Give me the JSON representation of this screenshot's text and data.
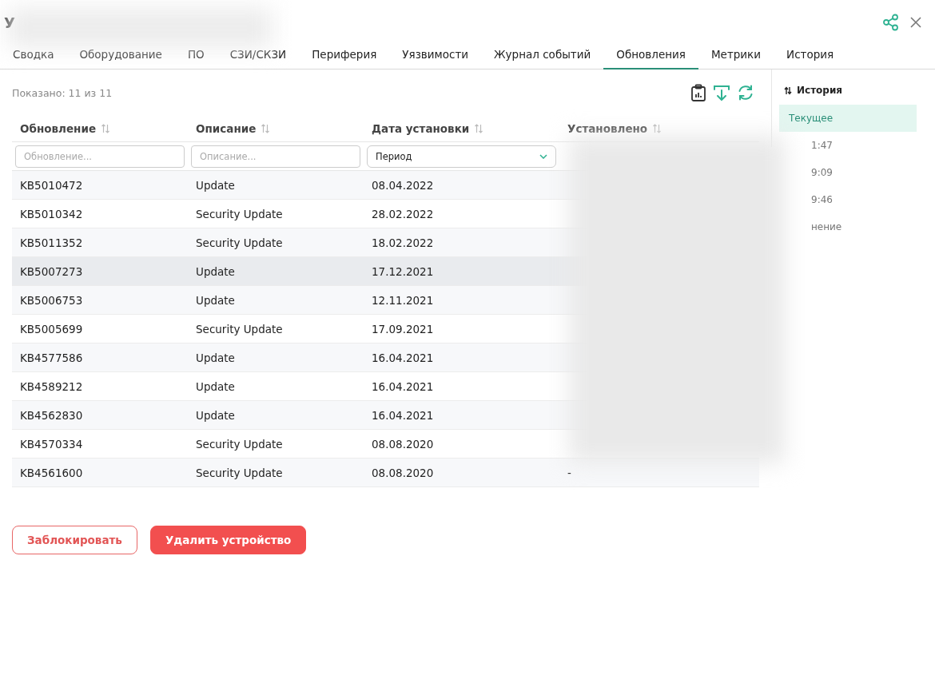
{
  "window": {
    "title": "У"
  },
  "tabs": [
    {
      "label": "Сводка",
      "selected": false
    },
    {
      "label": "Оборудование",
      "selected": false
    },
    {
      "label": "ПО",
      "selected": false
    },
    {
      "label": "СЗИ/СКЗИ",
      "selected": false
    },
    {
      "label": "Периферия",
      "selected": false
    },
    {
      "label": "Уязвимости",
      "selected": false
    },
    {
      "label": "Журнал событий",
      "selected": false
    },
    {
      "label": "Обновления",
      "selected": true
    },
    {
      "label": "Метрики",
      "selected": false
    },
    {
      "label": "История",
      "selected": false
    }
  ],
  "shown_count": "Показано: 11 из 11",
  "table": {
    "columns": [
      "Обновление",
      "Описание",
      "Дата установки",
      "Установлено"
    ],
    "filters": [
      {
        "kind": "text",
        "placeholder": "Обновление..."
      },
      {
        "kind": "text",
        "placeholder": "Описание..."
      },
      {
        "kind": "select",
        "value": "Период"
      }
    ],
    "rows": [
      {
        "update": "KB5010472",
        "description": "Update",
        "date": "08.04.2022",
        "highlighted": false
      },
      {
        "update": "KB5010342",
        "description": "Security Update",
        "date": "28.02.2022",
        "highlighted": false
      },
      {
        "update": "KB5011352",
        "description": "Security Update",
        "date": "18.02.2022",
        "highlighted": false
      },
      {
        "update": "KB5007273",
        "description": "Update",
        "date": "17.12.2021",
        "highlighted": true
      },
      {
        "update": "KB5006753",
        "description": "Update",
        "date": "12.11.2021",
        "highlighted": false
      },
      {
        "update": "KB5005699",
        "description": "Security Update",
        "date": "17.09.2021",
        "highlighted": false
      },
      {
        "update": "KB4577586",
        "description": "Update",
        "date": "16.04.2021",
        "highlighted": false
      },
      {
        "update": "KB4589212",
        "description": "Update",
        "date": "16.04.2021",
        "highlighted": false
      },
      {
        "update": "KB4562830",
        "description": "Update",
        "date": "16.04.2021",
        "highlighted": false
      },
      {
        "update": "KB4570334",
        "description": "Security Update",
        "date": "08.08.2020",
        "highlighted": false
      },
      {
        "update": "KB4561600",
        "description": "Security Update",
        "date": "08.08.2020",
        "installed": "-",
        "highlighted": false
      }
    ]
  },
  "history": {
    "title": "История",
    "items": [
      {
        "label": "Текущее",
        "selected": true
      },
      {
        "label": "1:47",
        "selected": false
      },
      {
        "label": "9:09",
        "selected": false
      },
      {
        "label": "9:46",
        "selected": false
      },
      {
        "label": "нение",
        "selected": false
      }
    ]
  },
  "buttons": [
    {
      "kind": "outline",
      "label": "Заблокировать"
    },
    {
      "kind": "danger",
      "label": "Удалить устройство"
    }
  ]
}
